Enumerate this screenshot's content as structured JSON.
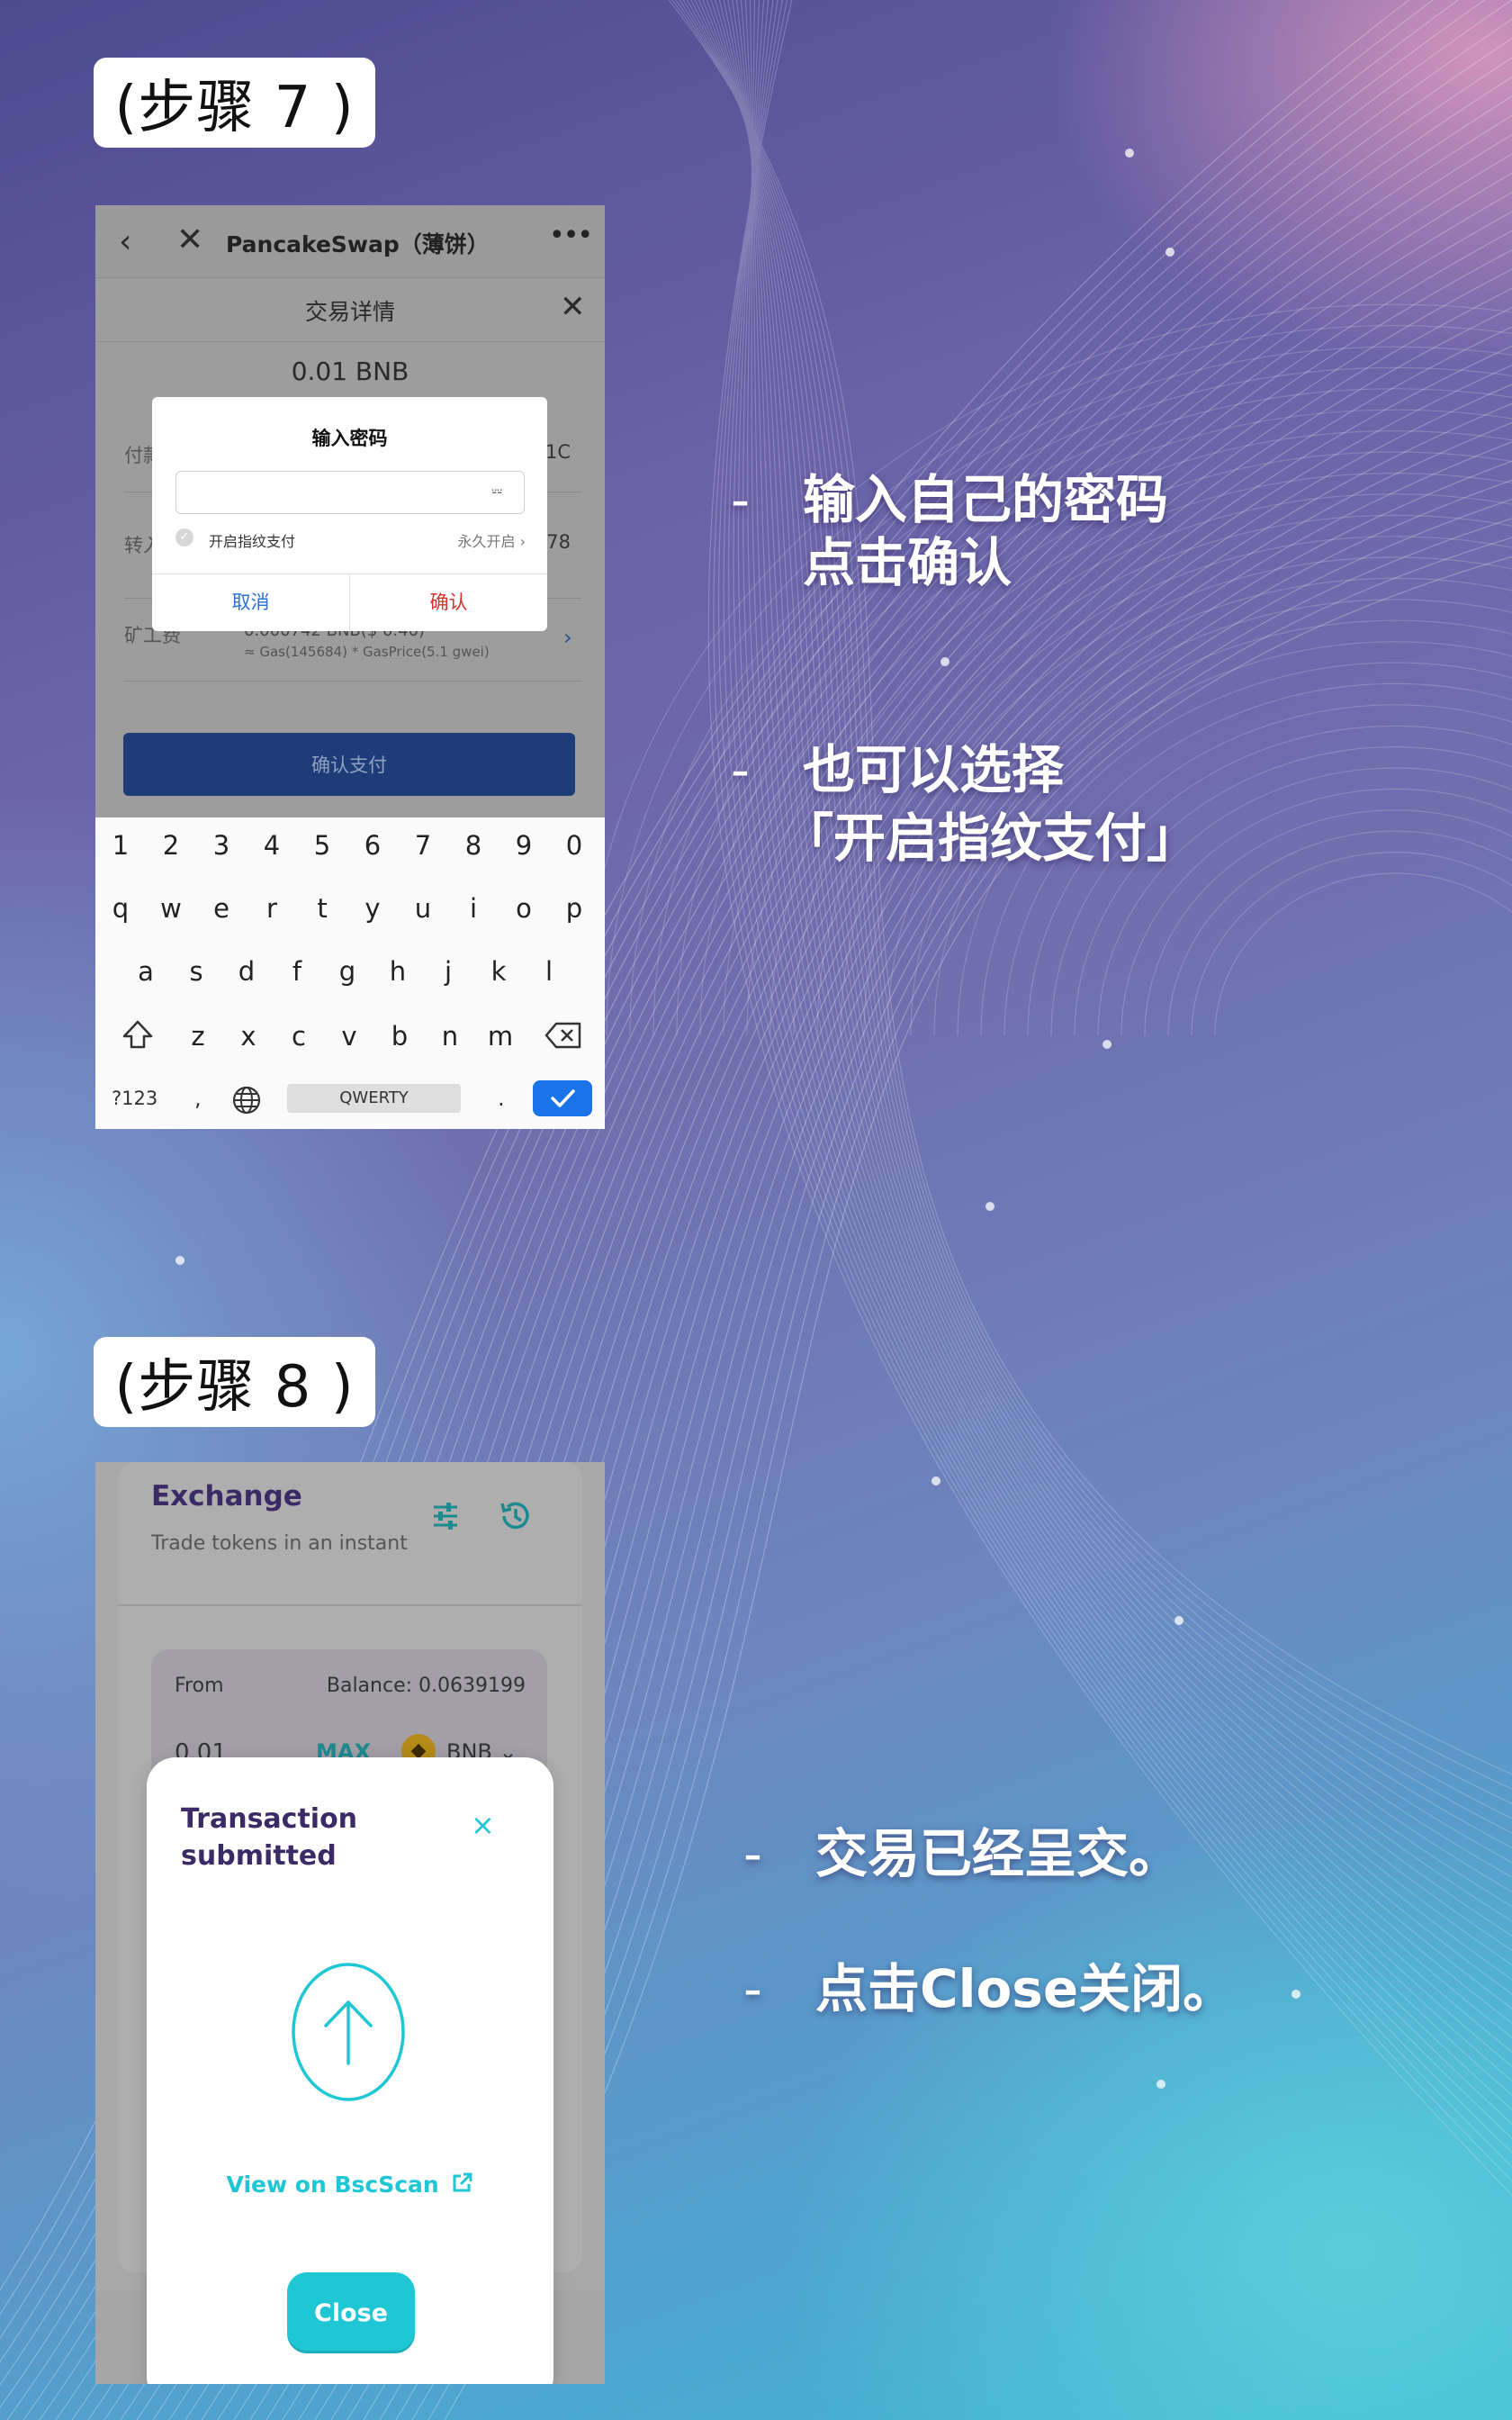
{
  "step7": {
    "label": "(步骤 7 )",
    "bullets": [
      {
        "dash": "-",
        "lines": [
          "输入自己的密码",
          "点击确认"
        ]
      },
      {
        "dash": "-",
        "lines": [
          "也可以选择",
          "「开启指纹支付」"
        ]
      }
    ],
    "screenshot": {
      "nav_title": "PancakeSwap（薄饼）",
      "nav_more": "•••",
      "sheet_title": "交易详情",
      "amount": "0.01 BNB",
      "rows": [
        {
          "label": "付款",
          "value": "1C"
        },
        {
          "label": "转入",
          "value": "78"
        },
        {
          "label": "矿工费",
          "value": ""
        }
      ],
      "fee_value": "0.000742 BNB($ 0.40)",
      "fee_detail": "≈ Gas(145684) * GasPrice(5.1 gwei)",
      "pay_button": "确认支付",
      "dialog": {
        "title": "输入密码",
        "password_placeholder": "",
        "fingerprint_label": "开启指纹支付",
        "fingerprint_right": "永久开启",
        "cancel": "取消",
        "confirm": "确认"
      },
      "keyboard": {
        "row1": [
          "1",
          "2",
          "3",
          "4",
          "5",
          "6",
          "7",
          "8",
          "9",
          "0"
        ],
        "row2": [
          "q",
          "w",
          "e",
          "r",
          "t",
          "y",
          "u",
          "i",
          "o",
          "p"
        ],
        "row3": [
          "a",
          "s",
          "d",
          "f",
          "g",
          "h",
          "j",
          "k",
          "l"
        ],
        "row4": [
          "z",
          "x",
          "c",
          "v",
          "b",
          "n",
          "m"
        ],
        "symbols": "?123",
        "comma": ",",
        "space": "QWERTY",
        "period": "."
      }
    }
  },
  "step8": {
    "label": "(步骤 8 )",
    "bullets": [
      {
        "dash": "-",
        "text": "交易已经呈交。"
      },
      {
        "dash": "-",
        "text": "点击Close关闭。"
      }
    ],
    "screenshot": {
      "title": "Exchange",
      "subtitle": "Trade tokens in an instant",
      "from_label": "From",
      "balance": "Balance: 0.0639199",
      "amount": "0.01",
      "max": "MAX",
      "token": "BNB",
      "modal": {
        "title": "Transaction submitted",
        "close_x": "×",
        "link": "View on BscScan",
        "button": "Close"
      }
    }
  },
  "colors": {
    "accent": "#1fc7d4",
    "brand_dark": "#3a2a66",
    "confirm_red": "#e02f2f",
    "cancel_blue": "#2b6ed8",
    "keyboard_enter": "#1a73e8"
  }
}
